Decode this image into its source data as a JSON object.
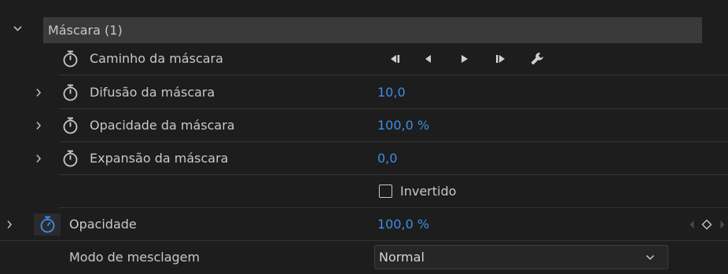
{
  "mask_group": {
    "title": "Máscara (1)"
  },
  "mask_path": {
    "label": "Caminho da máscara",
    "controls": {
      "prev_keyframe": "go-to-previous-keyframe-icon",
      "step_back": "step-backward-icon",
      "play": "play-icon",
      "next_keyframe": "go-to-next-keyframe-icon",
      "wrench": "wrench-icon"
    }
  },
  "mask_feather": {
    "label": "Difusão da máscara",
    "value": "10,0"
  },
  "mask_opacity": {
    "label": "Opacidade da máscara",
    "value": "100,0 %"
  },
  "mask_expansion": {
    "label": "Expansão da máscara",
    "value": "0,0"
  },
  "inverted": {
    "label": "Invertido",
    "checked": false
  },
  "opacity": {
    "label": "Opacidade",
    "value": "100,0 %"
  },
  "blend_mode": {
    "label": "Modo de mesclagem",
    "selected": "Normal"
  },
  "colors": {
    "background": "#1d1d1d",
    "header_background": "#3a3a3a",
    "value_blue": "#3b8ee8",
    "label_gray": "#c8c8c8"
  }
}
